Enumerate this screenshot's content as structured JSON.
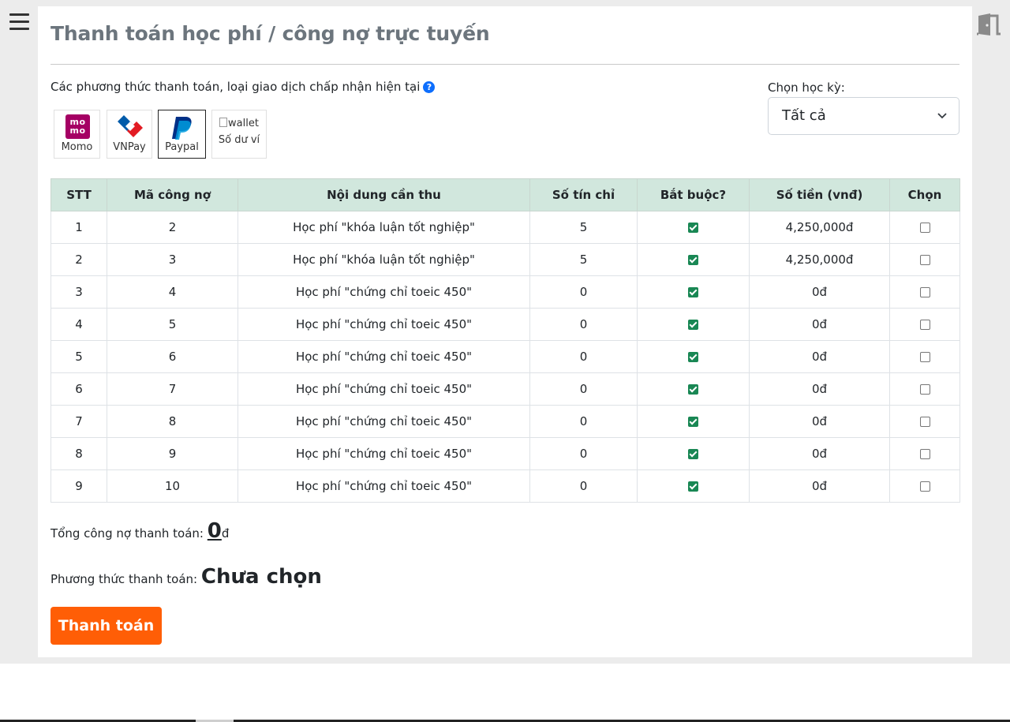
{
  "page": {
    "title": "Thanh toán học phí / công nợ trực tuyến",
    "methods_label": "Các phương thức thanh toán, loại giao dịch chấp nhận hiện tại",
    "help_glyph": "?"
  },
  "payment_methods": [
    {
      "label": "Momo",
      "logo_text": "mo mo",
      "icon": "momo-logo",
      "color": "#a50064"
    },
    {
      "label": "VNPay",
      "icon": "vnpay-logo",
      "color": "#e21b23"
    },
    {
      "label": "Paypal",
      "icon": "paypal-logo",
      "color": "#003087",
      "selected": true
    },
    {
      "label": "Số dư ví",
      "alt": "wallet",
      "icon": "broken-image-icon"
    }
  ],
  "semester": {
    "label": "Chọn học kỳ:",
    "value": "Tất cả"
  },
  "table": {
    "headers": [
      "STT",
      "Mã công nợ",
      "Nội dung cần thu",
      "Số tín chỉ",
      "Bắt buộc?",
      "Số tiền (vnđ)",
      "Chọn"
    ],
    "rows": [
      {
        "stt": "1",
        "ma": "2",
        "noi_dung": "Học phí \"khóa luận tốt nghiệp\"",
        "tin_chi": "5",
        "bat_buoc": true,
        "so_tien": "4,250,000đ",
        "chon": false
      },
      {
        "stt": "2",
        "ma": "3",
        "noi_dung": "Học phí \"khóa luận tốt nghiệp\"",
        "tin_chi": "5",
        "bat_buoc": true,
        "so_tien": "4,250,000đ",
        "chon": false
      },
      {
        "stt": "3",
        "ma": "4",
        "noi_dung": "Học phí \"chứng chỉ toeic 450\"",
        "tin_chi": "0",
        "bat_buoc": true,
        "so_tien": "0đ",
        "chon": false
      },
      {
        "stt": "4",
        "ma": "5",
        "noi_dung": "Học phí \"chứng chỉ toeic 450\"",
        "tin_chi": "0",
        "bat_buoc": true,
        "so_tien": "0đ",
        "chon": false
      },
      {
        "stt": "5",
        "ma": "6",
        "noi_dung": "Học phí \"chứng chỉ toeic 450\"",
        "tin_chi": "0",
        "bat_buoc": true,
        "so_tien": "0đ",
        "chon": false
      },
      {
        "stt": "6",
        "ma": "7",
        "noi_dung": "Học phí \"chứng chỉ toeic 450\"",
        "tin_chi": "0",
        "bat_buoc": true,
        "so_tien": "0đ",
        "chon": false
      },
      {
        "stt": "7",
        "ma": "8",
        "noi_dung": "Học phí \"chứng chỉ toeic 450\"",
        "tin_chi": "0",
        "bat_buoc": true,
        "so_tien": "0đ",
        "chon": false
      },
      {
        "stt": "8",
        "ma": "9",
        "noi_dung": "Học phí \"chứng chỉ toeic 450\"",
        "tin_chi": "0",
        "bat_buoc": true,
        "so_tien": "0đ",
        "chon": false
      },
      {
        "stt": "9",
        "ma": "10",
        "noi_dung": "Học phí \"chứng chỉ toeic 450\"",
        "tin_chi": "0",
        "bat_buoc": true,
        "so_tien": "0đ",
        "chon": false
      }
    ]
  },
  "summary": {
    "total_label": "Tổng công nợ thanh toán:",
    "total_value": "0",
    "currency": "đ",
    "method_label": "Phương thức thanh toán:",
    "method_value": "Chưa chọn"
  },
  "pay_button": {
    "label": "Thanh toán",
    "color": "#ff5e06"
  },
  "icons": {
    "menu": "hamburger-menu-icon",
    "logout": "door-exit-icon",
    "select": "chevron-down-icon",
    "required_check": "#198754",
    "header_bg": "#d1e7dd"
  }
}
